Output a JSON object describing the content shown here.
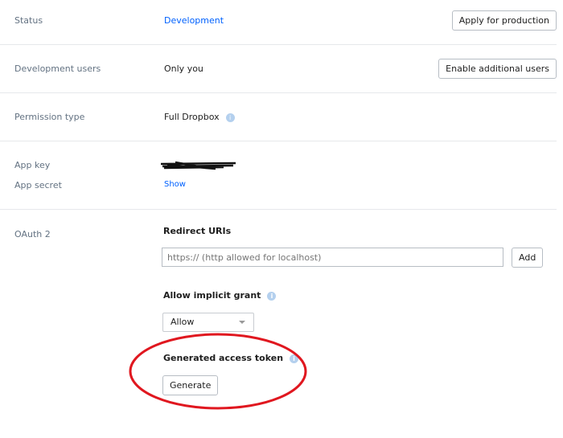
{
  "status": {
    "label": "Status",
    "value": "Development",
    "button": "Apply for production"
  },
  "dev_users": {
    "label": "Development users",
    "value": "Only you",
    "button": "Enable additional users"
  },
  "permission": {
    "label": "Permission type",
    "value": "Full Dropbox"
  },
  "keys": {
    "app_key_label": "App key",
    "app_secret_label": "App secret",
    "show_link": "Show"
  },
  "oauth": {
    "label": "OAuth 2",
    "redirect_title": "Redirect URIs",
    "redirect_placeholder": "https:// (http allowed for localhost)",
    "add_button": "Add",
    "implicit_title": "Allow implicit grant",
    "implicit_value": "Allow",
    "token_title": "Generated access token",
    "generate_button": "Generate"
  },
  "colors": {
    "link": "#0061fe",
    "annotation": "#e0171f"
  }
}
